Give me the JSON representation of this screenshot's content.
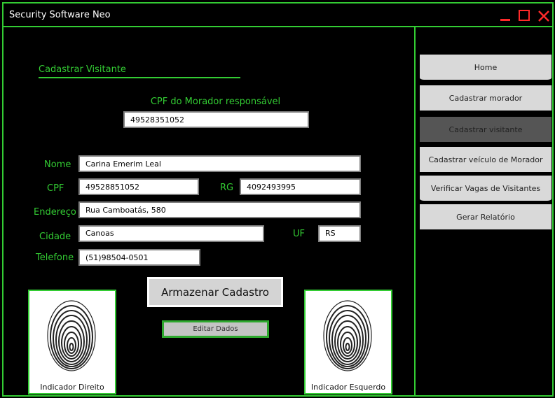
{
  "window": {
    "title": "Security Software Neo"
  },
  "controls": {
    "minimize": "minimize-icon",
    "maximize": "maximize-icon",
    "close": "close-icon",
    "color": "#ff2a2a"
  },
  "theme": {
    "accent": "#33cc33",
    "background": "#000000",
    "nav_bg": "#d9d9d9",
    "nav_active_bg": "#555555"
  },
  "form": {
    "heading": "Cadastrar Visitante",
    "cpf_morador_label": "CPF do Morador responsável",
    "cpf_morador_value": "49528351052",
    "nome_label": "Nome",
    "nome_value": "Carina Emerim Leal",
    "cpf_label": "CPF",
    "cpf_value": "49528851052",
    "rg_label": "RG",
    "rg_value": "4092493995",
    "endereco_label": "Endereço",
    "endereco_value": "Rua Camboatás, 580",
    "cidade_label": "Cidade",
    "cidade_value": "Canoas",
    "uf_label": "UF",
    "uf_value": "RS",
    "telefone_label": "Telefone",
    "telefone_value": "(51)98504-0501",
    "store_button": "Armazenar Cadastro",
    "edit_button": "Editar Dados"
  },
  "fingerprints": {
    "right_label": "Indicador Direito",
    "left_label": "Indicador Esquerdo",
    "icon": "fingerprint-icon"
  },
  "sidebar": {
    "items": [
      {
        "label": "Home"
      },
      {
        "label": "Cadastrar morador"
      },
      {
        "label": "Cadastrar visitante",
        "active": true
      },
      {
        "label": "Cadastrar veículo de Morador"
      },
      {
        "label": "Verificar Vagas de Visitantes"
      },
      {
        "label": "Gerar Relatório"
      }
    ]
  }
}
